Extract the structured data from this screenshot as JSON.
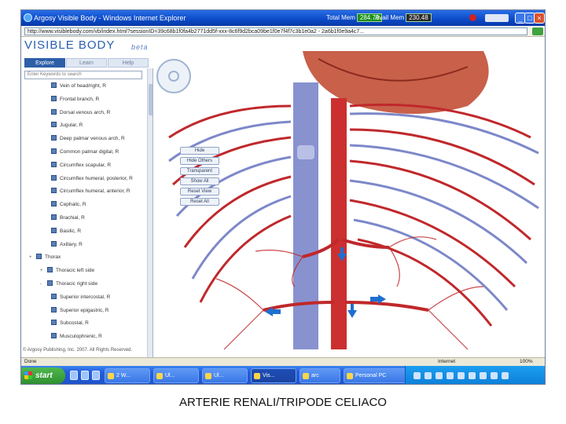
{
  "window": {
    "title": "Argosy Visible Body - Windows Internet Explorer",
    "stats": [
      {
        "label": "Total Mem",
        "value": "284.79",
        "dark": false
      },
      {
        "label": "Avail Mem",
        "value": "230.48",
        "dark": true
      }
    ],
    "controls": {
      "minimize": "_",
      "maximize": "□",
      "close": "×"
    }
  },
  "address_bar": {
    "url": "http://www.visiblebody.com/vb/index.html?sessionID=39c68b1f0fa4b2771dd5f-xxx-8c6f9d2bca09be1f0e7f4f7c3b1e0a2 - 2a6b1f0e9a4c7..."
  },
  "app": {
    "logo": "VISIBLE BODY",
    "logo_tag": "beta",
    "tabs": [
      {
        "label": "Explore",
        "active": true
      },
      {
        "label": "Learn",
        "active": false
      },
      {
        "label": "Help",
        "active": false
      }
    ],
    "search_placeholder": "Enter Keywords to search",
    "tree": [
      {
        "label": "Vein of head/right, R",
        "indent": 2,
        "icon": true
      },
      {
        "label": "Frontal branch, R",
        "indent": 2,
        "icon": true
      },
      {
        "label": "Dorsal venous arch, R",
        "indent": 2,
        "icon": true
      },
      {
        "label": "Jugular, R",
        "indent": 2,
        "icon": true
      },
      {
        "label": "Deep palmar venous arch, R",
        "indent": 2,
        "icon": true
      },
      {
        "label": "Common palmar digital, R",
        "indent": 2,
        "icon": true
      },
      {
        "label": "Circumflex scapular, R",
        "indent": 2,
        "icon": true
      },
      {
        "label": "Circumflex humeral, posterior, R",
        "indent": 2,
        "icon": true
      },
      {
        "label": "Circumflex humeral, anterior, R",
        "indent": 2,
        "icon": true
      },
      {
        "label": "Cephalic, R",
        "indent": 2,
        "icon": true
      },
      {
        "label": "Brachial, R",
        "indent": 2,
        "icon": true
      },
      {
        "label": "Basilic, R",
        "indent": 2,
        "icon": true
      },
      {
        "label": "Axillary, R",
        "indent": 2,
        "icon": true
      },
      {
        "label": "Thorax",
        "indent": 0,
        "icon": true,
        "expander": "+"
      },
      {
        "label": "Thoracic left side",
        "indent": 1,
        "icon": true,
        "expander": "+"
      },
      {
        "label": "Thoracic right side",
        "indent": 1,
        "icon": true,
        "expander": "-"
      },
      {
        "label": "Superior intercostal, R",
        "indent": 2,
        "icon": true
      },
      {
        "label": "Superior epigastric, R",
        "indent": 2,
        "icon": true
      },
      {
        "label": "Subcostal, R",
        "indent": 2,
        "icon": true
      },
      {
        "label": "Musculophrenic, R",
        "indent": 2,
        "icon": true
      }
    ],
    "copyright": "© Argosy Publishing, Inc. 2007. All Rights Reserved.",
    "view_buttons": [
      "Hide",
      "Hide Others",
      "Transparent",
      "Show All",
      "Reset View",
      "Reset All"
    ]
  },
  "status_bar": {
    "left": "Done",
    "zone": "Internet",
    "zoom": "100%"
  },
  "taskbar": {
    "start_label": "start",
    "tasks": [
      {
        "label": "2 W..."
      },
      {
        "label": "Ul..."
      },
      {
        "label": "Ul..."
      },
      {
        "label": "Vis...",
        "active": true
      },
      {
        "label": "arc"
      },
      {
        "label": "Personal PC"
      }
    ]
  },
  "caption": "ARTERIE RENALI/TRIPODE CELIACO",
  "colors": {
    "artery": "#c0282b",
    "vein": "#7d88c9",
    "accent": "#2d5fa8"
  }
}
